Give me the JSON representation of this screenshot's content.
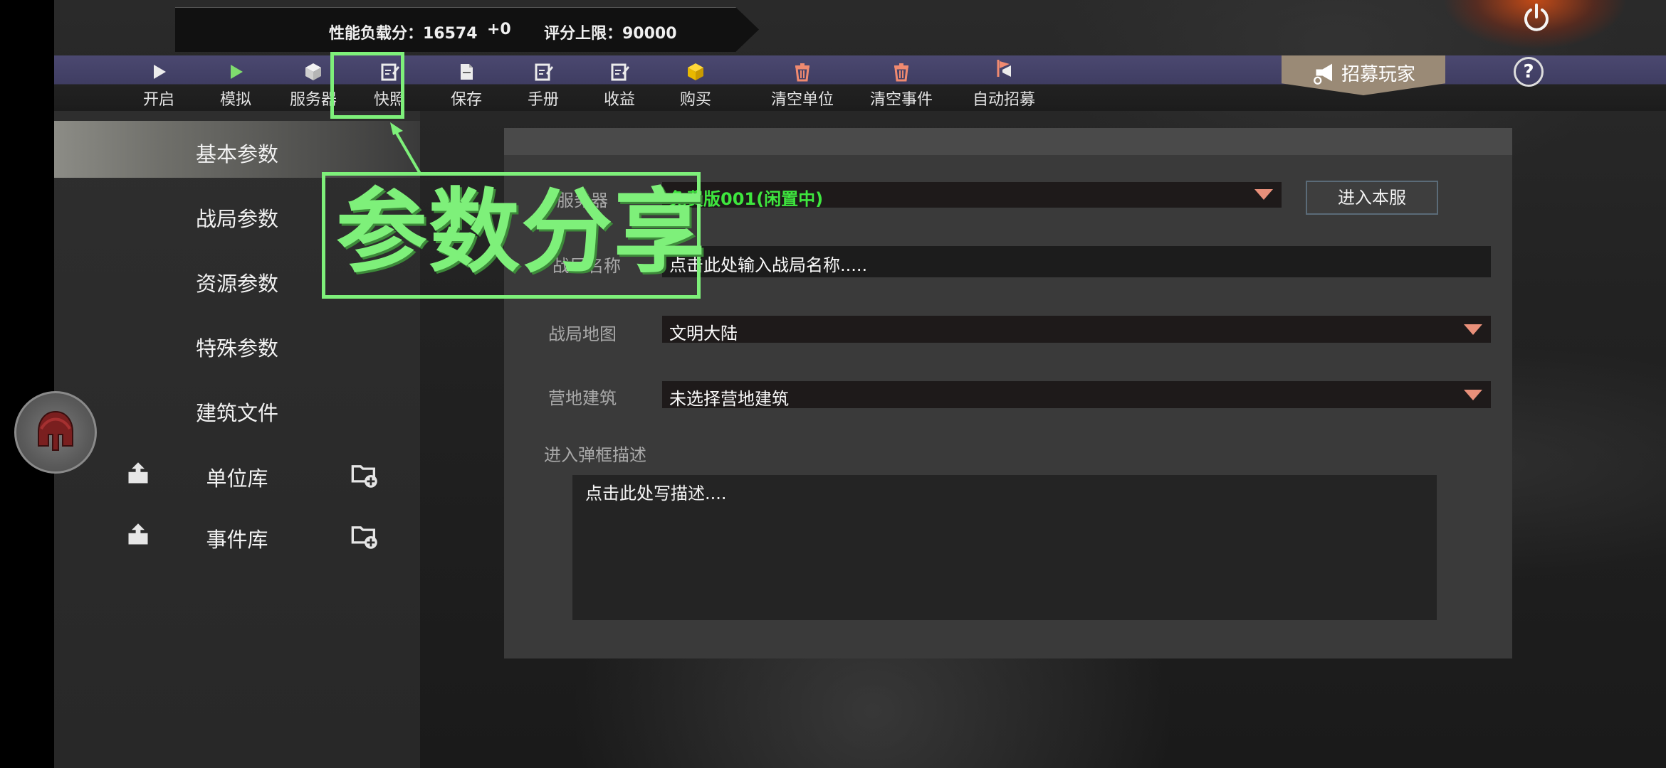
{
  "header": {
    "perf_load": "性能负载分：16574",
    "perf_delta": "+0",
    "score_cap": "评分上限：90000",
    "power_icon": "power-icon"
  },
  "toolbar": {
    "items": [
      {
        "label": "开启",
        "icon": "play-icon"
      },
      {
        "label": "模拟",
        "icon": "play-green-icon"
      },
      {
        "label": "服务器",
        "icon": "cube-icon"
      },
      {
        "label": "快照",
        "icon": "note-edit-icon"
      },
      {
        "label": "保存",
        "icon": "document-icon"
      },
      {
        "label": "手册",
        "icon": "note-edit-icon"
      },
      {
        "label": "收益",
        "icon": "note-edit-icon"
      },
      {
        "label": "购买",
        "icon": "gold-cube-icon"
      },
      {
        "label": "清空单位",
        "icon": "trash-icon"
      },
      {
        "label": "清空事件",
        "icon": "trash-icon"
      },
      {
        "label": "自动招募",
        "icon": "megaphone-flag-icon"
      }
    ],
    "recruit_label": "招募玩家",
    "help_label": "?"
  },
  "sidebar": {
    "items": [
      {
        "label": "基本参数",
        "active": true
      },
      {
        "label": "战局参数",
        "active": false
      },
      {
        "label": "资源参数",
        "active": false
      },
      {
        "label": "特殊参数",
        "active": false
      },
      {
        "label": "建筑文件",
        "active": false
      }
    ],
    "libraries": [
      {
        "label": "单位库"
      },
      {
        "label": "事件库"
      }
    ]
  },
  "form": {
    "server_label": "服务器",
    "server_value": "免费版001(闲置中)",
    "enter_server": "进入本服",
    "name_label": "战局名称",
    "name_placeholder": "点击此处输入战局名称.....",
    "map_label": "战局地图",
    "map_value": "文明大陆",
    "camp_label": "营地建筑",
    "camp_value": "未选择营地建筑",
    "desc_label": "进入弹框描述",
    "desc_placeholder": "点击此处写描述...."
  },
  "overlay": {
    "title": "参数分享"
  },
  "colors": {
    "accent_green": "#7ef07a",
    "server_status_green": "#3ee63e",
    "toolbar_purple": "#4b4870",
    "dropdown_arrow": "#e9907a"
  }
}
